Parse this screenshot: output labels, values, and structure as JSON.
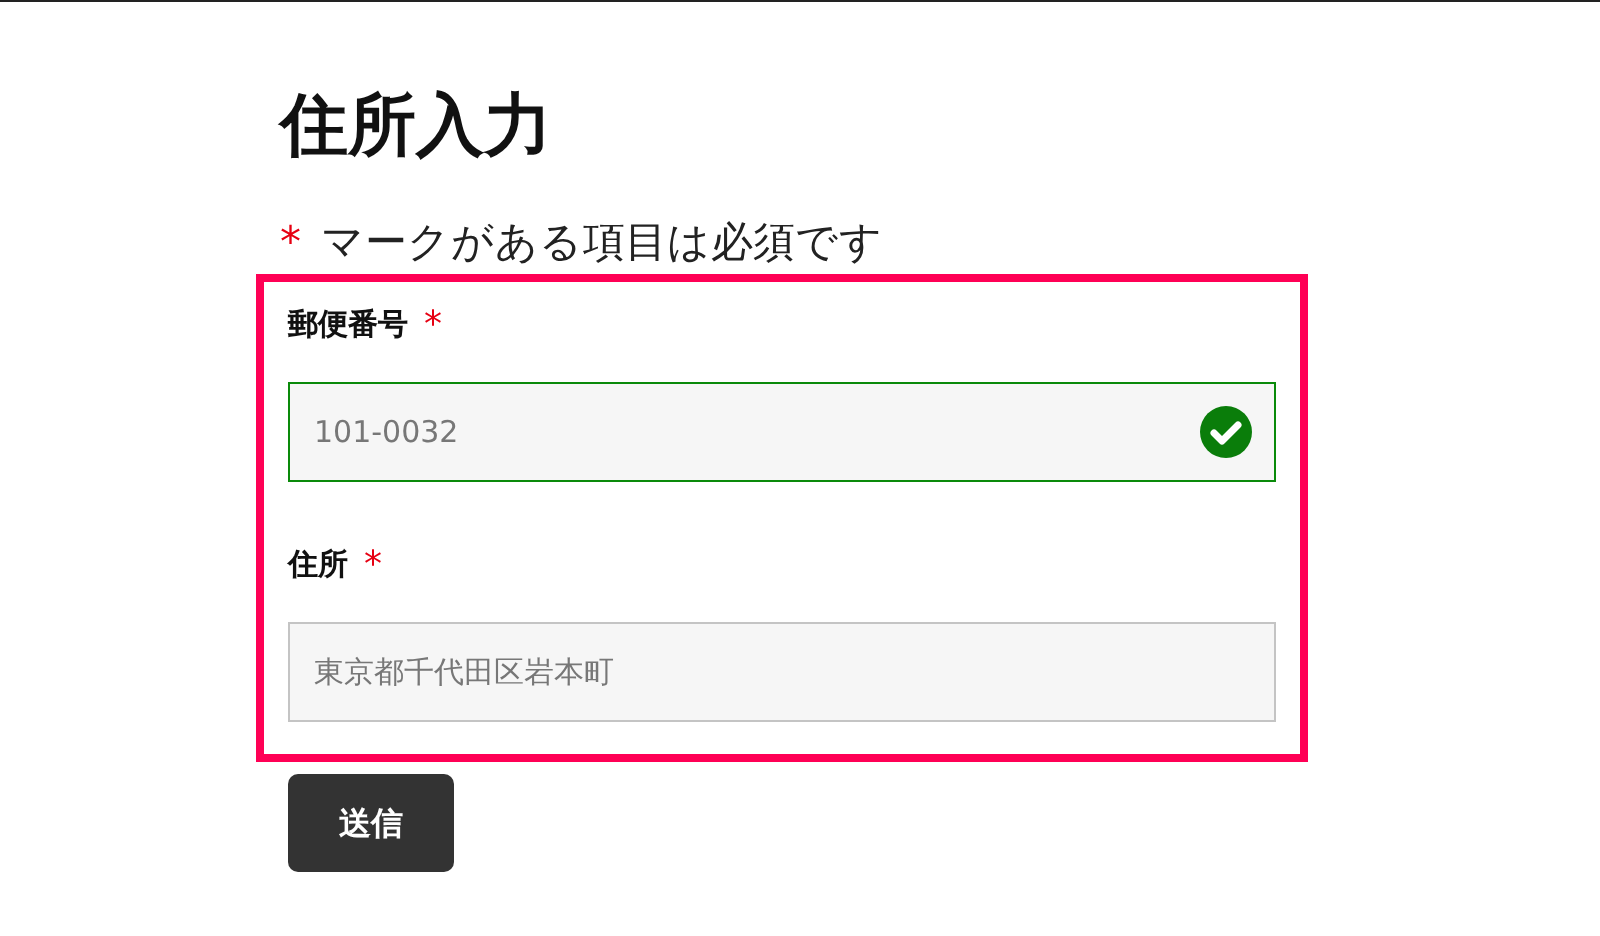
{
  "title": "住所入力",
  "required_note": {
    "mark": "*",
    "text": "マークがある項目は必須です"
  },
  "fields": [
    {
      "label": "郵便番号",
      "required_mark": "*",
      "value": "101-0032",
      "valid": true
    },
    {
      "label": "住所",
      "required_mark": "*",
      "value": "東京都千代田区岩本町",
      "valid": false
    }
  ],
  "submit_button": "送信"
}
